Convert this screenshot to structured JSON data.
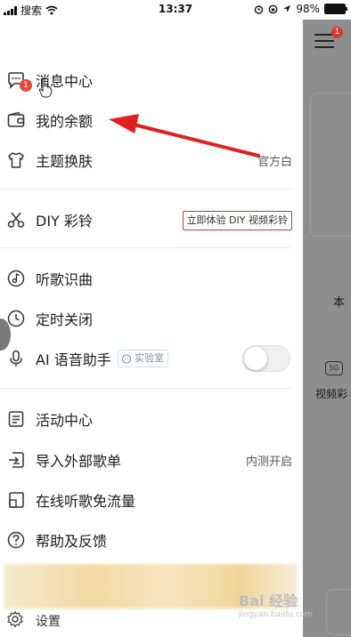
{
  "status_bar": {
    "carrier": "搜索",
    "time": "13:37",
    "battery": "98%",
    "battery_level": 0.98
  },
  "drawer": {
    "notification_count": "1",
    "items": [
      {
        "label": "消息中心",
        "icon": "message-bubble-icon"
      },
      {
        "label": "我的余额",
        "icon": "wallet-icon"
      },
      {
        "label": "主题换肤",
        "icon": "tshirt-icon",
        "value": "官方白"
      },
      {
        "label": "DIY 彩铃",
        "icon": "scissors-icon",
        "tag": "立即体验 DIY 视频彩铃"
      },
      {
        "label": "听歌识曲",
        "icon": "music-note-circle-icon"
      },
      {
        "label": "定时关闭",
        "icon": "clock-icon"
      },
      {
        "label": "AI 语音助手",
        "icon": "microphone-icon",
        "badge": "实验室",
        "toggle_on": false
      },
      {
        "label": "活动中心",
        "icon": "list-icon"
      },
      {
        "label": "导入外部歌单",
        "icon": "import-icon",
        "value": "内测开启"
      },
      {
        "label": "在线听歌免流量",
        "icon": "sim-card-icon"
      },
      {
        "label": "帮助及反馈",
        "icon": "question-circle-icon"
      }
    ],
    "settings_label": "设置"
  },
  "background": {
    "notification_count": "1",
    "text_1": "本",
    "text_2": "视频彩",
    "icon_5g": "5G"
  },
  "watermark": {
    "text": "Bai 经验",
    "sub": "jingyan.baidu.com"
  },
  "colors": {
    "accent_red": "#e8473a",
    "arrow_red": "#e02020",
    "dim_overlay": "#8e8e8e"
  }
}
